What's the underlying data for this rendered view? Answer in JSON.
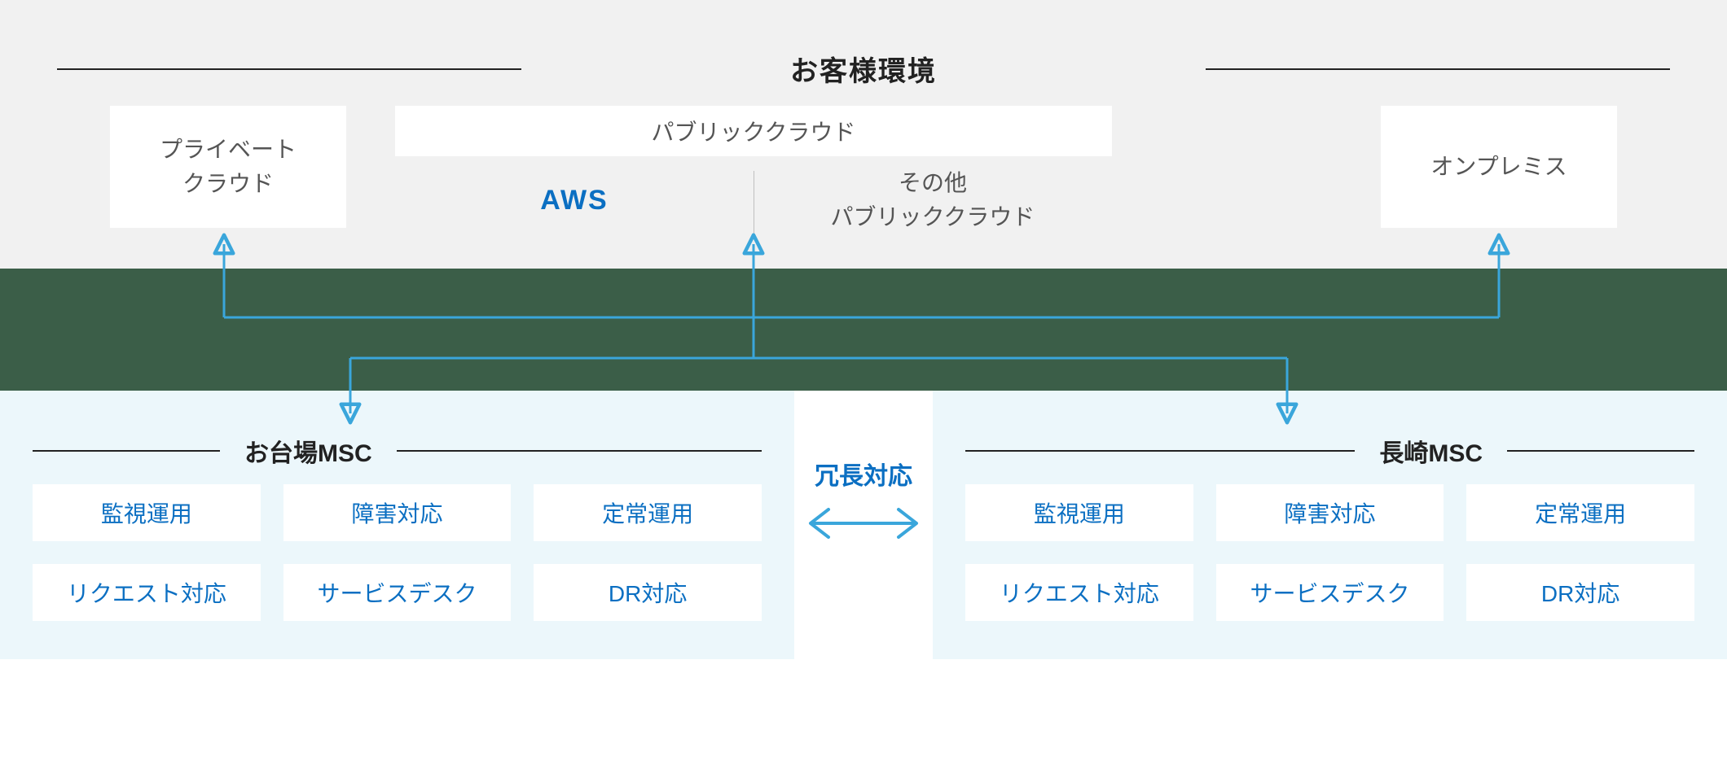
{
  "env": {
    "title": "お客様環境",
    "private": "プライベート\nクラウド",
    "public_title": "パブリッククラウド",
    "aws": "AWS",
    "public_other": "その他\nパブリッククラウド",
    "onprem": "オンプレミス"
  },
  "redundancy_label": "冗長対応",
  "msc_left": {
    "title": "お台場MSC",
    "chips": [
      "監視運用",
      "障害対応",
      "定常運用",
      "リクエスト対応",
      "サービスデスク",
      "DR対応"
    ]
  },
  "msc_right": {
    "title": "長崎MSC",
    "chips": [
      "監視運用",
      "障害対応",
      "定常運用",
      "リクエスト対応",
      "サービスデスク",
      "DR対応"
    ]
  },
  "colors": {
    "accent": "#3aa6db",
    "blue_text": "#0b6fc2",
    "green": "#3b5e48",
    "panel": "#f1f1f1",
    "msc_bg": "#ecf7fb"
  }
}
